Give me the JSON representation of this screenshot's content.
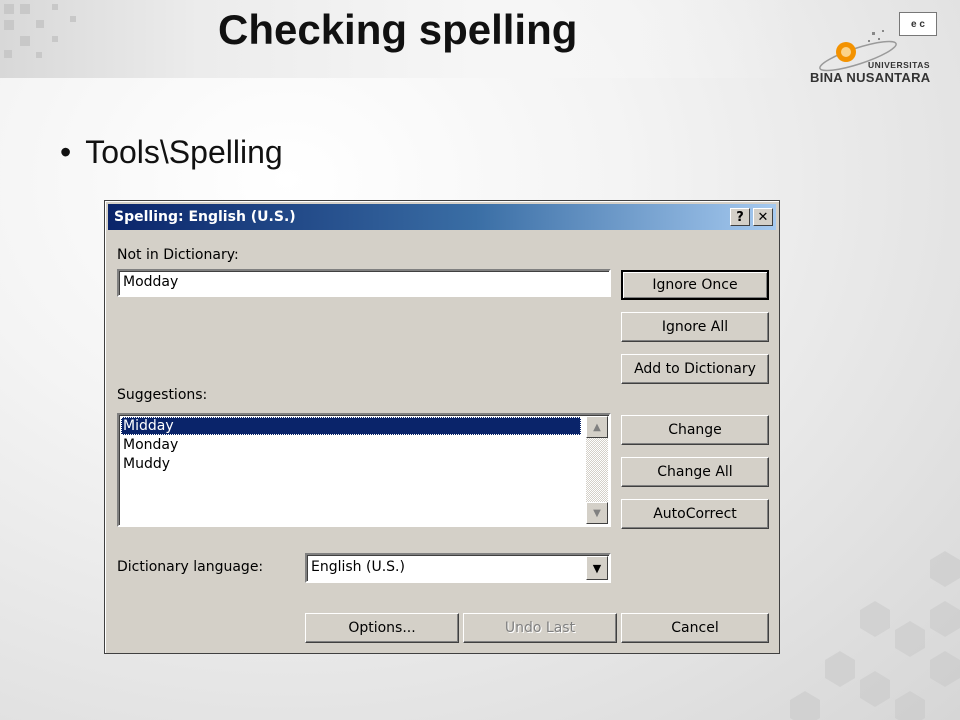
{
  "slide": {
    "title": "Checking spelling",
    "bullet": "Tools\\Spelling"
  },
  "logo": {
    "line1": "UNIVERSITAS",
    "line2": "BINA NUSANTARA",
    "corner_badge": "e c"
  },
  "dialog": {
    "title": "Spelling: English (U.S.)",
    "help_button": "?",
    "close_button": "✕",
    "not_in_dictionary_label": "Not in Dictionary:",
    "not_in_dictionary_value": "Modday",
    "suggestions_label": "Suggestions:",
    "suggestions": [
      "Midday",
      "Monday",
      "Muddy"
    ],
    "selected_suggestion": "Midday",
    "dictionary_language_label": "Dictionary language:",
    "dictionary_language_value": "English (U.S.)",
    "buttons": {
      "ignore_once": "Ignore Once",
      "ignore_all": "Ignore All",
      "add_to_dictionary": "Add to Dictionary",
      "change": "Change",
      "change_all": "Change All",
      "autocorrect": "AutoCorrect",
      "options": "Options...",
      "undo_last": "Undo Last",
      "cancel": "Cancel"
    }
  },
  "colors": {
    "titlebar_start": "#0a246a",
    "titlebar_end": "#a6caf0",
    "selection": "#0a246a",
    "dialog_face": "#d4d0c8",
    "logo_orange": "#f39200"
  }
}
